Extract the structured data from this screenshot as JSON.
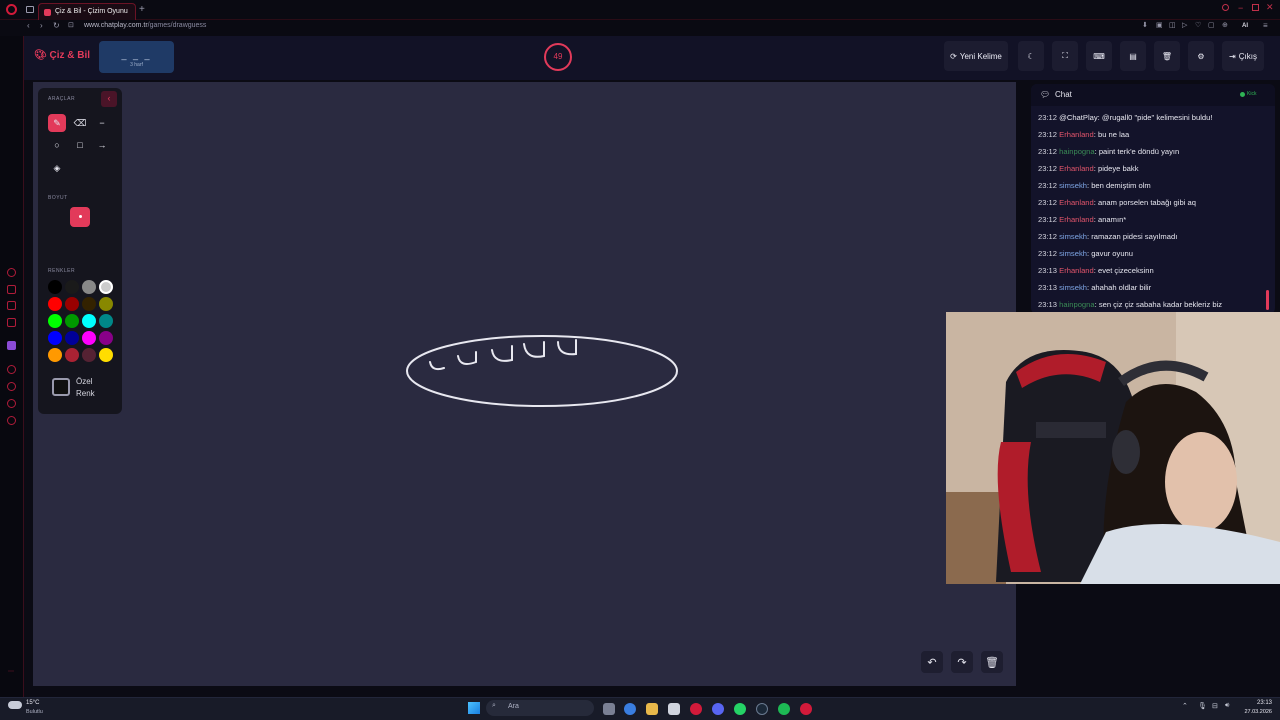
{
  "browser": {
    "tab_title": "Çiz & Bil - Çizim Oyunu",
    "url_domain": "www.chatplay.com.tr",
    "url_path": "/games/drawguess",
    "ai_label": "AI"
  },
  "app": {
    "logo": "Çiz & Bil",
    "word_mask": "_ _ _",
    "word_length": "3 harf",
    "timer": "49",
    "buttons": {
      "new_word": "Yeni Kelime",
      "exit": "Çıkış"
    }
  },
  "tools": {
    "section_tools": "ARAÇLAR",
    "section_size": "BOYUT",
    "section_colors": "RENKLER",
    "custom_color_line1": "Özel",
    "custom_color_line2": "Renk",
    "palette": [
      [
        "#000000",
        "#1a1a1a",
        "#888888",
        "#cccccc"
      ],
      [
        "#ff0000",
        "#990000",
        "#332200",
        "#888800"
      ],
      [
        "#00ff00",
        "#009900",
        "#00ffff",
        "#008888"
      ],
      [
        "#0000ff",
        "#000099",
        "#ff00ff",
        "#880088"
      ],
      [
        "#ff9900",
        "#aa2233",
        "#552233",
        "#ffdd00"
      ]
    ],
    "active_color": "#e23a5a"
  },
  "chat": {
    "title": "Chat",
    "status": "Kick",
    "messages": [
      {
        "time": "23:12",
        "user": "",
        "text": "@ChatPlay: @rugall0 \"pide\" kelimesini buldu!",
        "color": "#e6e6ef"
      },
      {
        "time": "23:12",
        "user": "Erhanland",
        "text": ": bu ne laa",
        "color": "#e2556b"
      },
      {
        "time": "23:12",
        "user": "hainpogna",
        "text": ": paint terk'e döndü yayın",
        "color": "#3a8a55"
      },
      {
        "time": "23:12",
        "user": "Erhanland",
        "text": ": pideye bakk",
        "color": "#e2556b"
      },
      {
        "time": "23:12",
        "user": "simsekh",
        "text": ": ben demiştim olm",
        "color": "#7fa6e6"
      },
      {
        "time": "23:12",
        "user": "Erhanland",
        "text": ": anam porselen tabağı gibi aq",
        "color": "#e2556b"
      },
      {
        "time": "23:12",
        "user": "Erhanland",
        "text": ": anamın*",
        "color": "#e2556b"
      },
      {
        "time": "23:12",
        "user": "simsekh",
        "text": ": ramazan pidesi sayılmadı",
        "color": "#7fa6e6"
      },
      {
        "time": "23:12",
        "user": "simsekh",
        "text": ": gavur oyunu",
        "color": "#7fa6e6"
      },
      {
        "time": "23:13",
        "user": "Erhanland",
        "text": ": evet çizeceksinn",
        "color": "#e2556b"
      },
      {
        "time": "23:13",
        "user": "simsekh",
        "text": ": ahahah oldlar bilir",
        "color": "#7fa6e6"
      },
      {
        "time": "23:13",
        "user": "hainpogna",
        "text": ": sen çiz çiz sabaha kadar bekleriz biz",
        "color": "#3a8a55"
      }
    ]
  },
  "taskbar": {
    "temp": "15°C",
    "weather": "Bulutlu",
    "search": "Ara",
    "time": "23:13",
    "date": "27.03.2026"
  }
}
